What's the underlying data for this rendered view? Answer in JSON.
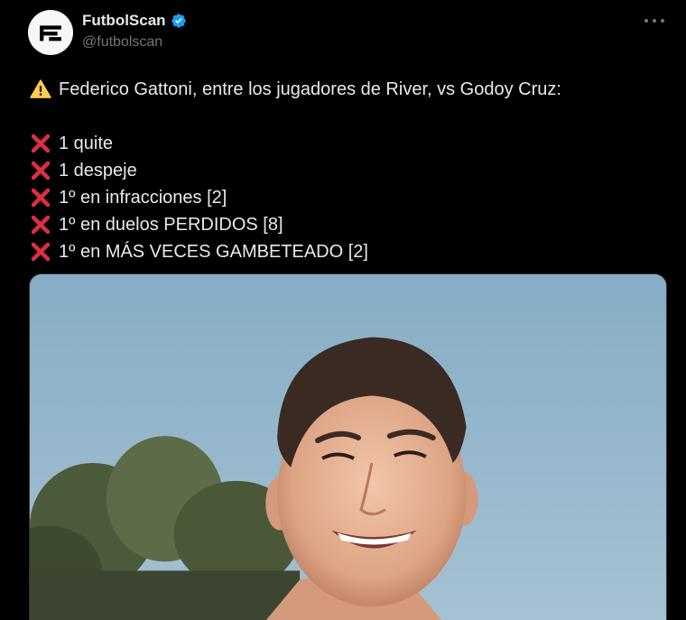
{
  "author": {
    "display_name": "FutbolScan",
    "handle": "@futbolscan",
    "verified": true,
    "avatar_icon": "futbolscan-logo-icon"
  },
  "colors": {
    "background": "#000000",
    "text": "#e7e9ea",
    "muted": "#71767b",
    "verified": "#1d9bf0",
    "cross": "#dd2e44",
    "warning": "#ffcc4d"
  },
  "tweet": {
    "intro": {
      "icon": "warning-icon",
      "text": "Federico Gattoni, entre los jugadores de River, vs Godoy Cruz:"
    },
    "items": [
      {
        "icon": "cross-mark-icon",
        "text": "1 quite"
      },
      {
        "icon": "cross-mark-icon",
        "text": "1 despeje"
      },
      {
        "icon": "cross-mark-icon",
        "text": "1º en infracciones [2]"
      },
      {
        "icon": "cross-mark-icon",
        "text": "1º en duelos PERDIDOS [8]"
      },
      {
        "icon": "cross-mark-icon",
        "text": "1º en MÁS VECES GAMBETEADO [2]"
      }
    ]
  },
  "media": {
    "kind": "photo",
    "subject": "player-portrait"
  }
}
